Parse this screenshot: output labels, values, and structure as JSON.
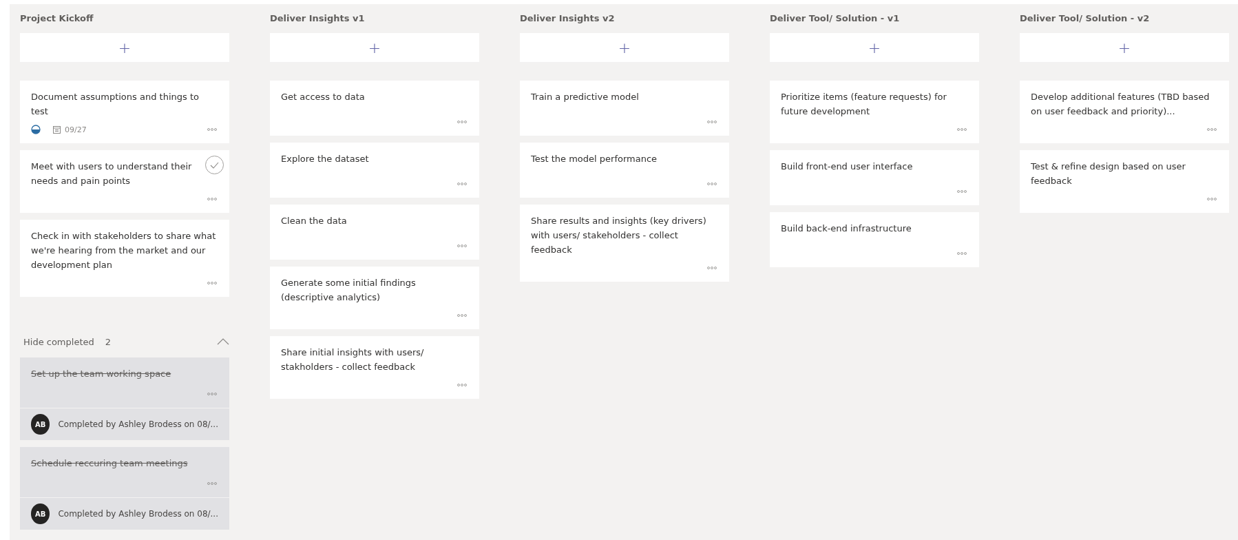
{
  "columns": [
    {
      "title": "Project Kickoff",
      "add_label": "+",
      "cards": [
        {
          "title": "Document assumptions and things to test",
          "in_progress": true,
          "due": "09/27",
          "check_shown": false
        },
        {
          "title": "Meet with users to understand their needs and pain points",
          "check_shown": true
        },
        {
          "title": "Check in with stakeholders to share what we're hearing from the market and our development plan",
          "check_shown": false
        }
      ],
      "completed": {
        "label": "Hide completed",
        "count": "2",
        "expanded": true,
        "cards": [
          {
            "title": "Set up the team working space",
            "initials": "AB",
            "note": "Completed by Ashley Brodess on 08/..."
          },
          {
            "title": "Schedule reccuring team meetings",
            "initials": "AB",
            "note": "Completed by Ashley Brodess on 08/..."
          }
        ]
      }
    },
    {
      "title": "Deliver Insights v1",
      "add_label": "+",
      "cards": [
        {
          "title": "Get access to data",
          "check_shown": false
        },
        {
          "title": "Explore the dataset",
          "check_shown": false
        },
        {
          "title": "Clean the data",
          "check_shown": false
        },
        {
          "title": "Generate some initial findings (descriptive analytics)",
          "check_shown": false
        },
        {
          "title": "Share initial insights with users/ stakholders - collect feedback",
          "check_shown": false
        }
      ]
    },
    {
      "title": "Deliver Insights v2",
      "add_label": "+",
      "cards": [
        {
          "title": "Train a predictive model",
          "check_shown": false
        },
        {
          "title": "Test the model performance",
          "check_shown": false
        },
        {
          "title": "Share results and insights (key drivers) with users/ stakeholders - collect feedback",
          "check_shown": false
        }
      ]
    },
    {
      "title": "Deliver Tool/ Solution - v1",
      "add_label": "+",
      "cards": [
        {
          "title": "Prioritize items (feature requests) for future development",
          "check_shown": false
        },
        {
          "title": "Build front-end user interface",
          "check_shown": false
        },
        {
          "title": "Build back-end infrastructure",
          "check_shown": false
        }
      ]
    },
    {
      "title": "Deliver Tool/ Solution - v2",
      "add_label": "+",
      "cards": [
        {
          "title": "Develop additional features (TBD based on user feedback and priority)...",
          "check_shown": false
        },
        {
          "title": "Test & refine design based on user feedback",
          "check_shown": false
        }
      ]
    }
  ]
}
